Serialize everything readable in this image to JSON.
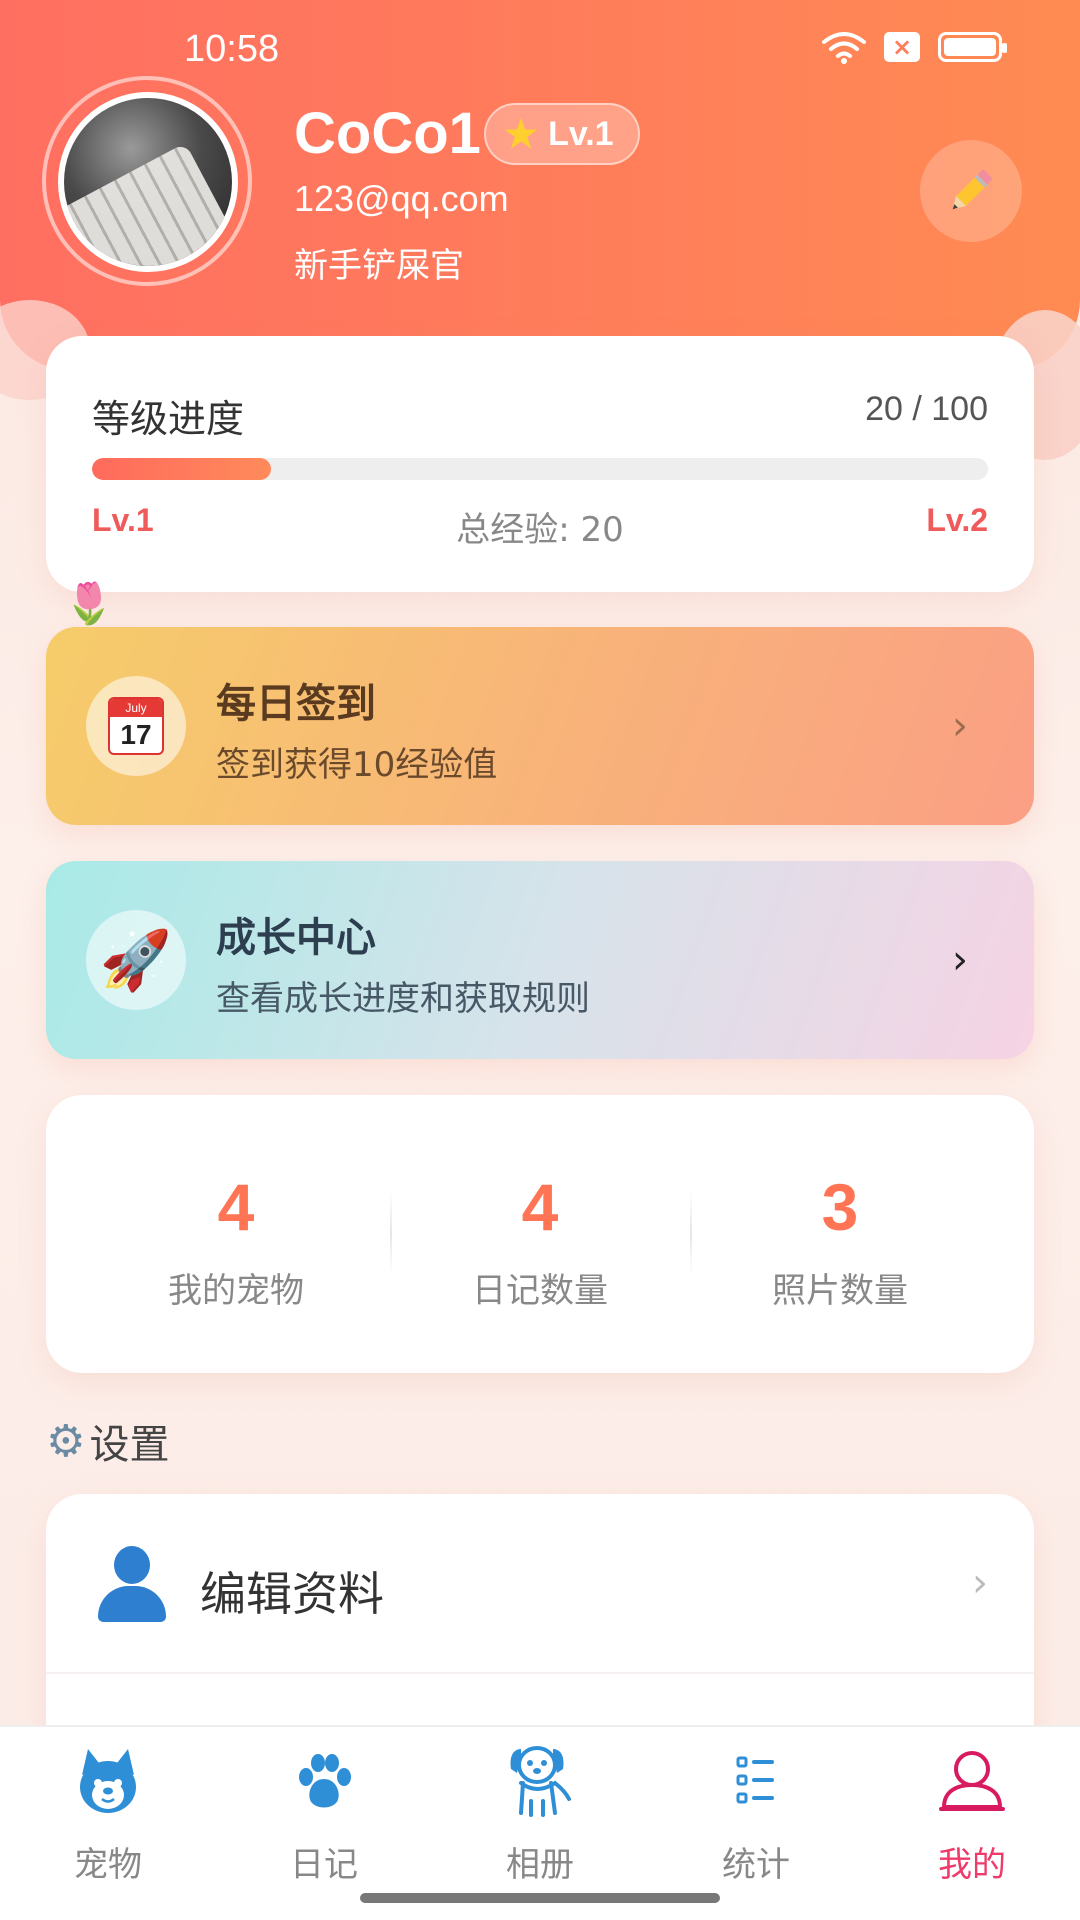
{
  "status_bar": {
    "time": "10:58"
  },
  "profile": {
    "username": "CoCo1",
    "level_badge": "Lv.1",
    "email": "123@qq.com",
    "title": "新手铲屎官"
  },
  "level_progress": {
    "heading": "等级进度",
    "ratio_text": "20 / 100",
    "progress_fraction": 0.2,
    "current_level": "Lv.1",
    "total_exp": "总经验: 20",
    "next_level": "Lv.2"
  },
  "daily_checkin": {
    "title": "每日签到",
    "subtitle": "签到获得10经验值",
    "icon": "calendar-icon",
    "calendar_month": "July",
    "calendar_day": "17"
  },
  "growth_center": {
    "title": "成长中心",
    "subtitle": "查看成长进度和获取规则",
    "icon": "rocket-icon"
  },
  "stats": [
    {
      "value": "4",
      "label": "我的宠物"
    },
    {
      "value": "4",
      "label": "日记数量"
    },
    {
      "value": "3",
      "label": "照片数量"
    }
  ],
  "settings": {
    "heading": "设置",
    "items": [
      {
        "label": "编辑资料",
        "icon": "user-icon"
      }
    ]
  },
  "tabs": [
    {
      "label": "宠物",
      "icon": "husky-icon",
      "active": false
    },
    {
      "label": "日记",
      "icon": "paw-icon",
      "active": false
    },
    {
      "label": "相册",
      "icon": "dog-icon",
      "active": false
    },
    {
      "label": "统计",
      "icon": "list-icon",
      "active": false
    },
    {
      "label": "我的",
      "icon": "profile-icon",
      "active": true
    }
  ],
  "colors": {
    "header_gradient_start": "#ff6f61",
    "header_gradient_end": "#ff8b52",
    "accent": "#ff7454",
    "active_tab": "#ef3a6a",
    "tab_icon_blue": "#2e8fd6"
  }
}
